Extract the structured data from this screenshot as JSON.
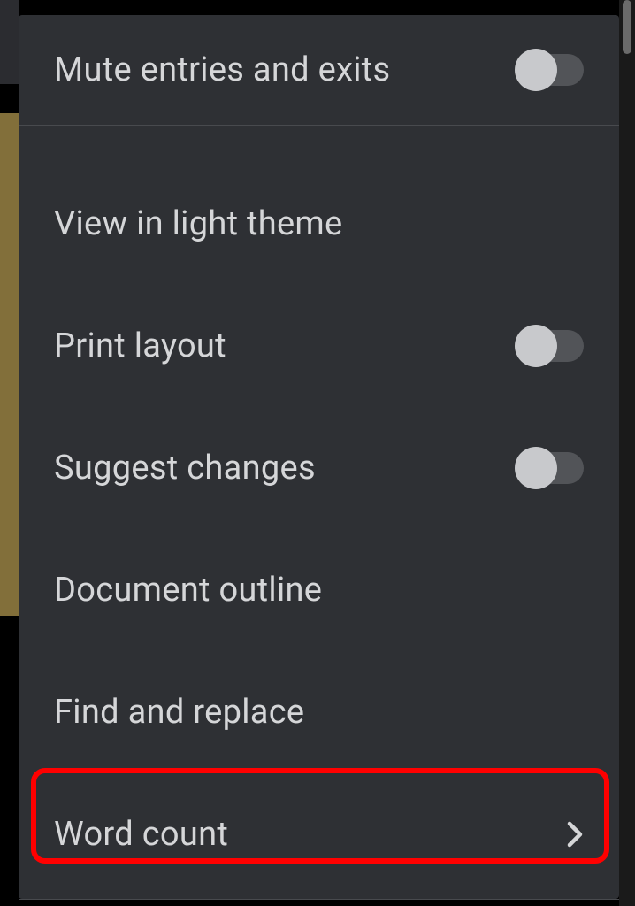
{
  "menu": {
    "mute_label": "Mute entries and exits",
    "light_theme_label": "View in light theme",
    "print_layout_label": "Print layout",
    "suggest_changes_label": "Suggest changes",
    "document_outline_label": "Document outline",
    "find_replace_label": "Find and replace",
    "word_count_label": "Word count",
    "mute_toggle": false,
    "print_layout_toggle": false,
    "suggest_changes_toggle": false
  },
  "highlight": {
    "target": "word-count"
  }
}
